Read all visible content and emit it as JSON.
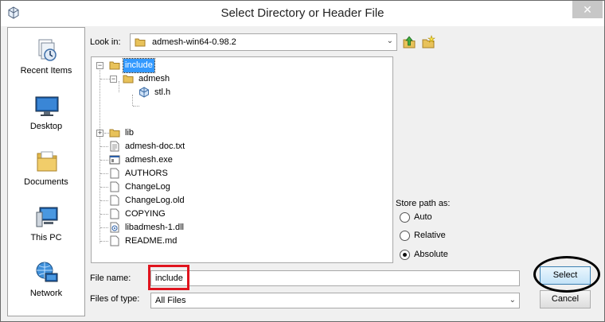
{
  "window": {
    "title": "Select Directory or Header File",
    "close_symbol": "✕"
  },
  "places": [
    {
      "label": "Recent Items",
      "icon": "recent-items-icon"
    },
    {
      "label": "Desktop",
      "icon": "desktop-icon"
    },
    {
      "label": "Documents",
      "icon": "documents-icon"
    },
    {
      "label": "This PC",
      "icon": "this-pc-icon"
    },
    {
      "label": "Network",
      "icon": "network-icon"
    }
  ],
  "look_in": {
    "label": "Look in:",
    "value": "admesh-win64-0.98.2"
  },
  "toolbar": {
    "up_icon": "up-one-level-icon",
    "new_folder_icon": "new-folder-icon"
  },
  "tree": [
    {
      "label": "include",
      "type": "folder",
      "expanded": true,
      "selected": true
    },
    {
      "label": "admesh",
      "type": "folder",
      "expanded": true
    },
    {
      "label": "stl.h",
      "type": "header-file"
    },
    {
      "label": "lib",
      "type": "folder",
      "expanded": false
    },
    {
      "label": "admesh-doc.txt",
      "type": "text-file"
    },
    {
      "label": "admesh.exe",
      "type": "exe-file"
    },
    {
      "label": "AUTHORS",
      "type": "file"
    },
    {
      "label": "ChangeLog",
      "type": "file"
    },
    {
      "label": "ChangeLog.old",
      "type": "file"
    },
    {
      "label": "COPYING",
      "type": "file"
    },
    {
      "label": "libadmesh-1.dll",
      "type": "dll-file"
    },
    {
      "label": "README.md",
      "type": "file"
    }
  ],
  "store_path": {
    "label": "Store path as:",
    "options": [
      "Auto",
      "Relative",
      "Absolute"
    ],
    "selected": "Absolute"
  },
  "file_name": {
    "label": "File name:",
    "value": "include"
  },
  "files_of_type": {
    "label": "Files of type:",
    "value": "All Files"
  },
  "buttons": {
    "select": "Select",
    "cancel": "Cancel"
  },
  "annotation_colors": {
    "red_box": "#e0141e",
    "ellipse": "#000000"
  }
}
